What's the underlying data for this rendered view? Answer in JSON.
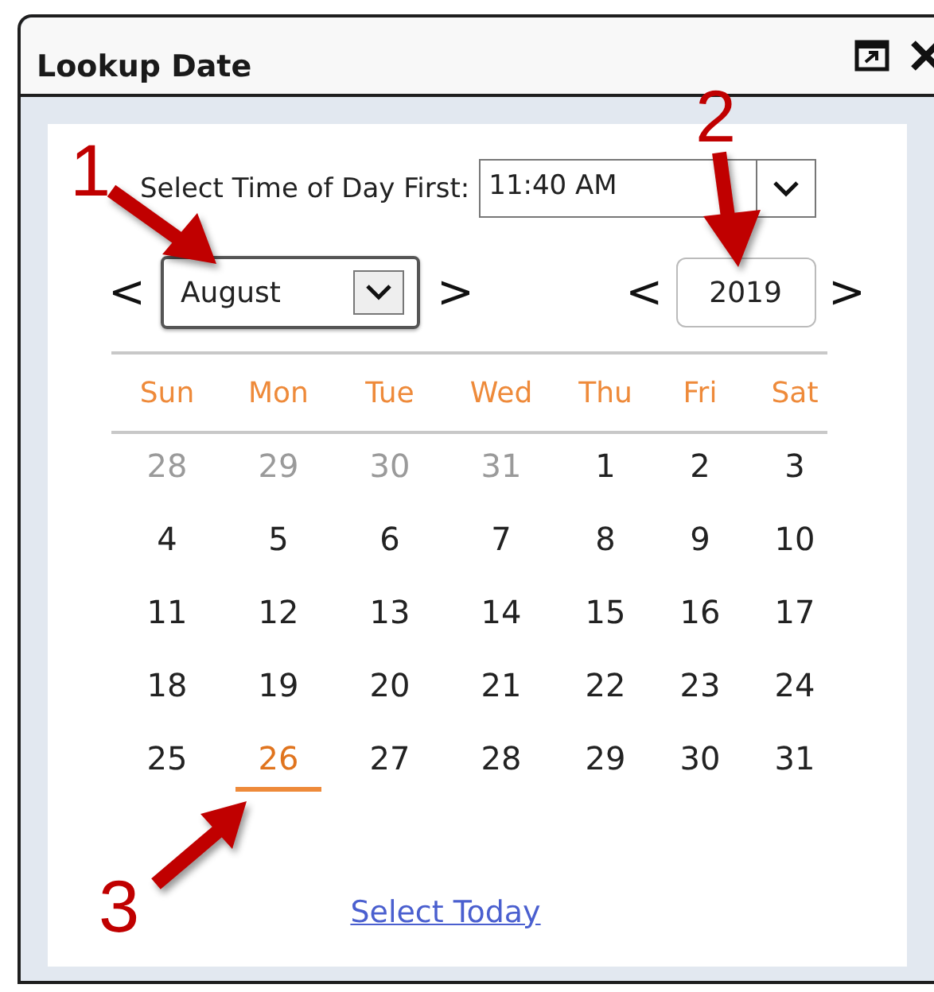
{
  "window": {
    "title": "Lookup Date"
  },
  "time": {
    "label": "Select Time of Day First:",
    "value": "11:40 AM"
  },
  "month": {
    "prev": "<",
    "value": "August",
    "next": ">"
  },
  "year": {
    "prev": "<",
    "value": "2019",
    "next": ">"
  },
  "weekdays": [
    "Sun",
    "Mon",
    "Tue",
    "Wed",
    "Thu",
    "Fri",
    "Sat"
  ],
  "weeks": [
    [
      {
        "day": "28",
        "muted": true,
        "today": false
      },
      {
        "day": "29",
        "muted": true,
        "today": false
      },
      {
        "day": "30",
        "muted": true,
        "today": false
      },
      {
        "day": "31",
        "muted": true,
        "today": false
      },
      {
        "day": "1",
        "muted": false,
        "today": false
      },
      {
        "day": "2",
        "muted": false,
        "today": false
      },
      {
        "day": "3",
        "muted": false,
        "today": false
      }
    ],
    [
      {
        "day": "4",
        "muted": false,
        "today": false
      },
      {
        "day": "5",
        "muted": false,
        "today": false
      },
      {
        "day": "6",
        "muted": false,
        "today": false
      },
      {
        "day": "7",
        "muted": false,
        "today": false
      },
      {
        "day": "8",
        "muted": false,
        "today": false
      },
      {
        "day": "9",
        "muted": false,
        "today": false
      },
      {
        "day": "10",
        "muted": false,
        "today": false
      }
    ],
    [
      {
        "day": "11",
        "muted": false,
        "today": false
      },
      {
        "day": "12",
        "muted": false,
        "today": false
      },
      {
        "day": "13",
        "muted": false,
        "today": false
      },
      {
        "day": "14",
        "muted": false,
        "today": false
      },
      {
        "day": "15",
        "muted": false,
        "today": false
      },
      {
        "day": "16",
        "muted": false,
        "today": false
      },
      {
        "day": "17",
        "muted": false,
        "today": false
      }
    ],
    [
      {
        "day": "18",
        "muted": false,
        "today": false
      },
      {
        "day": "19",
        "muted": false,
        "today": false
      },
      {
        "day": "20",
        "muted": false,
        "today": false
      },
      {
        "day": "21",
        "muted": false,
        "today": false
      },
      {
        "day": "22",
        "muted": false,
        "today": false
      },
      {
        "day": "23",
        "muted": false,
        "today": false
      },
      {
        "day": "24",
        "muted": false,
        "today": false
      }
    ],
    [
      {
        "day": "25",
        "muted": false,
        "today": false
      },
      {
        "day": "26",
        "muted": false,
        "today": true
      },
      {
        "day": "27",
        "muted": false,
        "today": false
      },
      {
        "day": "28",
        "muted": false,
        "today": false
      },
      {
        "day": "29",
        "muted": false,
        "today": false
      },
      {
        "day": "30",
        "muted": false,
        "today": false
      },
      {
        "day": "31",
        "muted": false,
        "today": false
      }
    ]
  ],
  "select_today": "Select Today",
  "callouts": [
    {
      "label": "1"
    },
    {
      "label": "2"
    },
    {
      "label": "3"
    }
  ]
}
